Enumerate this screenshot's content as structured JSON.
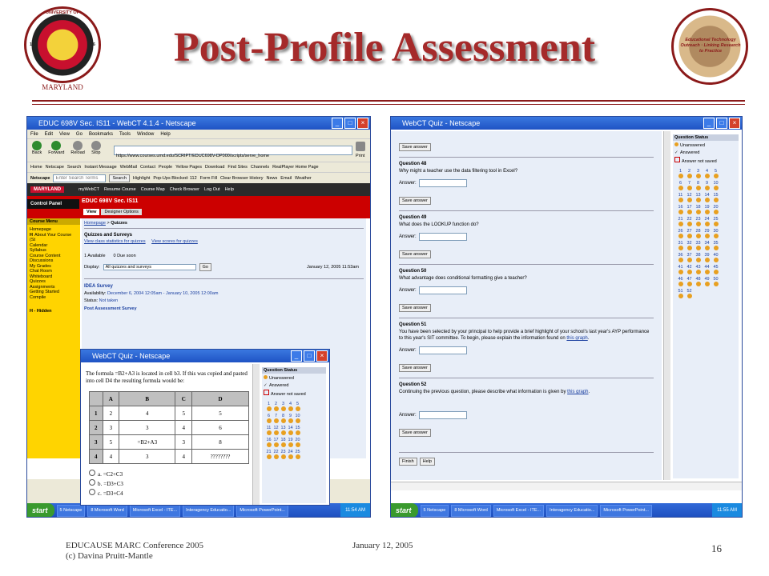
{
  "slide": {
    "title": "Post-Profile Assessment",
    "seal_text_top": "UNIVERSITY OF",
    "seal_text_bottom": "MARYLAND",
    "seal_year_left": "18",
    "seal_year_right": "56",
    "right_logo_text": "Educational Technology Outreach · Linking Research to Practice",
    "footer_left_1": "EDUCAUSE MARC Conference 2005",
    "footer_left_2": "(c) Davina Pruitt-Mantle",
    "footer_date": "January 12, 2005",
    "page_number": "16"
  },
  "left": {
    "window_title": "EDUC 698V Sec. IS11 - WebCT 4.1.4 - Netscape",
    "menu": [
      "File",
      "Edit",
      "View",
      "Go",
      "Bookmarks",
      "Tools",
      "Window",
      "Help"
    ],
    "nav_buttons": [
      "Back",
      "Forward",
      "Reload",
      "Stop"
    ],
    "print_label": "Print",
    "url": "https://www.courses.umd.edu/SCRIPT/EDUC698V-DP000/scripts/serve_home",
    "bookmarks": [
      "Home",
      "Netscape",
      "Search",
      "Instant Message",
      "WebMail",
      "Contact",
      "People",
      "Yellow Pages",
      "Download",
      "Find Sites",
      "Channels",
      "RealPlayer Home Page"
    ],
    "netscape_label": "Netscape",
    "search_placeholder": "Enter Search Terms",
    "search_btn": "Search",
    "highlight_btn": "Highlight",
    "popups": "Pop-Ups Blocked: 112",
    "form_fill": "Form Fill",
    "clear_history": "Clear Browser History",
    "news": "News",
    "email": "Email",
    "weather": "Weather",
    "webct_nav": [
      "myWebCT",
      "Resume Course",
      "Course Map",
      "Check Browser",
      "Log Out",
      "Help"
    ],
    "umd_badge": "MARYLAND",
    "course_title": "EDUC 698V Sec. IS11",
    "tabs": [
      "View",
      "Designer Options"
    ],
    "control_panel": "Control Panel",
    "course_menu": "Course Menu",
    "course_menu_items": [
      "Homepage",
      "About Your Course (St",
      "Calendar",
      "Syllabus",
      "Course Content",
      "Discussions",
      "My Grades",
      "Chat Room",
      "Whiteboard",
      "Quizzes",
      "Assignments",
      "Getting Started",
      "Compile"
    ],
    "hidden_label": "H - Hidden",
    "h_marker": "H",
    "breadcrumb_home": "Homepage",
    "breadcrumb_sep": " > ",
    "breadcrumb_current": "Quizzes",
    "page_heading": "Quizzes and Surveys",
    "view_class_stats": "View class statistics for quizzes",
    "view_scores": "View scores for quizzes",
    "available": "1 Available",
    "due_soon": "0 Due soon",
    "display_label": "Display:",
    "display_value": "All quizzes and surveys",
    "go_btn": "Go",
    "date_time": "January 12, 2005 11:53am",
    "idea_survey": "IDEA Survey",
    "availability_label": "Availability:",
    "availability_value": "December 6, 2004 12:05am - January 10, 2005 12:00am",
    "status_label": "Status:",
    "status_value": "Not taken",
    "post_survey": "Post Assessment Survey"
  },
  "popup": {
    "window_title": "WebCT Quiz - Netscape",
    "question_text": "The formula =B2+A3 is located in cell b3. If this was copied and pasted into cell D4 the resulting formula would be:",
    "table_headers": [
      "",
      "A",
      "B",
      "C",
      "D"
    ],
    "table_rows": [
      [
        "1",
        "2",
        "4",
        "5",
        "5"
      ],
      [
        "2",
        "3",
        "3",
        "4",
        "6"
      ],
      [
        "3",
        "5",
        "=B2+A3",
        "3",
        "8"
      ],
      [
        "4",
        "4",
        "3",
        "4",
        "????????"
      ]
    ],
    "options": [
      {
        "letter": "a.",
        "text": "=C2+C3"
      },
      {
        "letter": "b.",
        "text": "=D3+C3"
      },
      {
        "letter": "c.",
        "text": "=D3+C4"
      }
    ],
    "status_heading": "Question Status",
    "legend": [
      "Unanswered",
      "Answered",
      "Answer not saved"
    ],
    "numbers": [
      "1",
      "2",
      "3",
      "4",
      "5",
      "6",
      "7",
      "8",
      "9",
      "10",
      "11",
      "12",
      "13",
      "14",
      "15",
      "16",
      "17",
      "18",
      "19",
      "20",
      "21",
      "22",
      "23",
      "24",
      "25"
    ]
  },
  "left_taskbar": {
    "start": "start",
    "tasks": [
      "5 Netscape",
      "8 Microsoft Word",
      "Microsoft Excel - ITE...",
      "Interagency Educatio...",
      "Microsoft PowerPoint..."
    ],
    "clock": "11:54 AM"
  },
  "right": {
    "window_title": "WebCT Quiz - Netscape",
    "save_answer": "Save answer",
    "answer_label": "Answer:",
    "questions": [
      {
        "title": "Question 48",
        "text": "Why might a teacher use the data filtering tool in Excel?"
      },
      {
        "title": "Question 49",
        "text": "What does the LOOKUP function do?"
      },
      {
        "title": "Question 50",
        "text": "What advantage does conditional formatting give a teacher?"
      },
      {
        "title": "Question 51",
        "text": "You have been selected by your principal to help provide a brief highlight of your school's last year's AYP performance to this year's SIT committee. To begin, please explain the information found on",
        "link": "this graph"
      },
      {
        "title": "Question 52",
        "text": "Continuing the previous question, please describe what information is given by",
        "link": "this graph"
      }
    ],
    "finish_btn": "Finish",
    "help_btn": "Help",
    "status_heading": "Question Status",
    "legend": [
      "Unanswered",
      "Answered",
      "Answer not saved"
    ],
    "numbers": [
      "1",
      "2",
      "3",
      "4",
      "5",
      "6",
      "7",
      "8",
      "9",
      "10",
      "11",
      "12",
      "13",
      "14",
      "15",
      "16",
      "17",
      "18",
      "19",
      "20",
      "21",
      "22",
      "23",
      "24",
      "25",
      "26",
      "27",
      "28",
      "29",
      "30",
      "31",
      "32",
      "33",
      "34",
      "35",
      "36",
      "37",
      "38",
      "39",
      "40",
      "41",
      "42",
      "43",
      "44",
      "45",
      "46",
      "47",
      "48",
      "49",
      "50",
      "51",
      "52"
    ]
  },
  "right_taskbar": {
    "start": "start",
    "tasks": [
      "5 Netscape",
      "8 Microsoft Word",
      "Microsoft Excel - ITE...",
      "Interagency Educatio...",
      "Microsoft PowerPoint..."
    ],
    "clock": "11:55 AM"
  }
}
